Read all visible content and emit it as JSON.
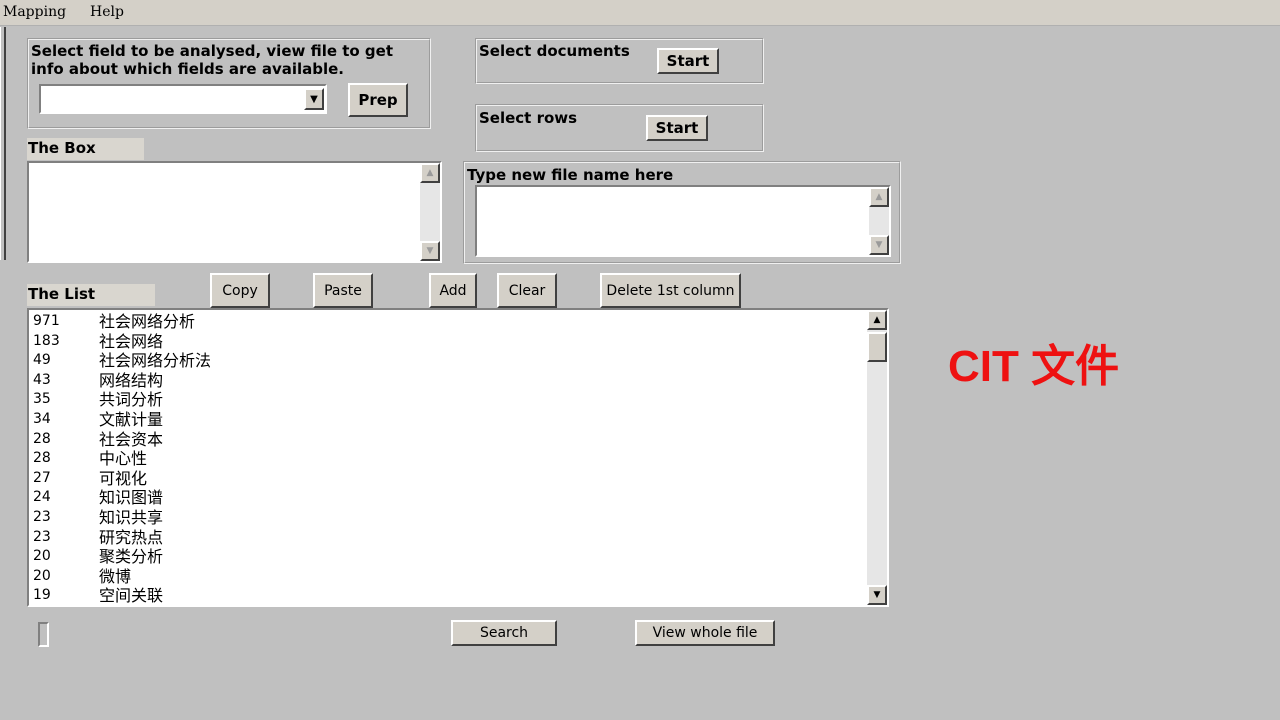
{
  "menu": {
    "items": [
      {
        "id": "mapping",
        "label": "Mapping"
      },
      {
        "id": "help",
        "label": "Help"
      }
    ]
  },
  "field_box": {
    "instruction": "Select field to be analysed, view file to get info about which fields are available.",
    "dropdown_value": "",
    "prep_label": "Prep"
  },
  "documents": {
    "label": "Select documents",
    "start_label": "Start"
  },
  "rows": {
    "label": "Select rows",
    "start_label": "Start"
  },
  "the_box": {
    "label": "The Box",
    "value": ""
  },
  "new_file": {
    "label": "Type new file name here",
    "value": ""
  },
  "the_list": {
    "label": "The List",
    "buttons": {
      "copy": "Copy",
      "paste": "Paste",
      "add": "Add",
      "clear": "Clear",
      "delete_first_column": "Delete 1st column"
    },
    "rows": [
      {
        "count": "971",
        "term": "社会网络分析"
      },
      {
        "count": "183",
        "term": "社会网络"
      },
      {
        "count": "49",
        "term": "社会网络分析法"
      },
      {
        "count": "43",
        "term": "网络结构"
      },
      {
        "count": "35",
        "term": "共词分析"
      },
      {
        "count": "34",
        "term": "文献计量"
      },
      {
        "count": "28",
        "term": "社会资本"
      },
      {
        "count": "28",
        "term": "中心性"
      },
      {
        "count": "27",
        "term": "可视化"
      },
      {
        "count": "24",
        "term": "知识图谱"
      },
      {
        "count": "23",
        "term": "知识共享"
      },
      {
        "count": "23",
        "term": "研究热点"
      },
      {
        "count": "20",
        "term": "聚类分析"
      },
      {
        "count": "20",
        "term": "微博"
      },
      {
        "count": "19",
        "term": "空间关联"
      }
    ]
  },
  "bottom": {
    "search_label": "Search",
    "view_whole_file_label": "View whole file"
  },
  "overlay": {
    "text": "CIT 文件",
    "color": "#ee1111"
  }
}
